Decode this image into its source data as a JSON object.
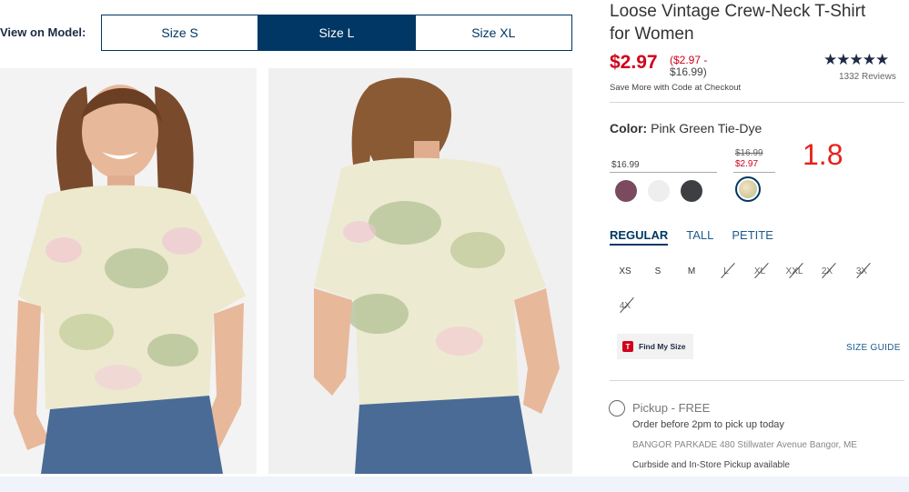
{
  "view_on_model": {
    "label": "View on Model:",
    "options": [
      "Size S",
      "Size L",
      "Size XL"
    ],
    "selected": "Size L"
  },
  "product": {
    "title": "Loose Vintage Crew-Neck T-Shirt for Women",
    "price": "$2.97",
    "price_range_sale": "($2.97 -",
    "price_range_regular": "$16.99)",
    "save_more": "Save More with Code at Checkout",
    "rating_stars": "★★★★★",
    "reviews": "1332 Reviews"
  },
  "color": {
    "label": "Color:",
    "value": "Pink Green Tie-Dye",
    "regular_price": "$16.99",
    "strike_price": "$16.99",
    "sale_price": "$2.97",
    "swatch_colors": [
      "#7b4a5e",
      "#eeeeee",
      "#3d3f42"
    ],
    "selected_swatch": "tie-dye"
  },
  "annotation": "1.8",
  "fit": {
    "tabs": [
      "REGULAR",
      "TALL",
      "PETITE"
    ],
    "selected": "REGULAR"
  },
  "sizes": [
    {
      "label": "XS",
      "available": true
    },
    {
      "label": "S",
      "available": true
    },
    {
      "label": "M",
      "available": true
    },
    {
      "label": "L",
      "available": false
    },
    {
      "label": "XL",
      "available": false
    },
    {
      "label": "XXL",
      "available": false
    },
    {
      "label": "2X",
      "available": false
    },
    {
      "label": "3X",
      "available": false
    },
    {
      "label": "4X",
      "available": false
    }
  ],
  "find_my_size": {
    "icon_letter": "T",
    "label": "Find My Size"
  },
  "size_guide": "SIZE GUIDE",
  "pickup": {
    "label": "Pickup - FREE",
    "order_before": "Order before 2pm to pick up today",
    "store": "BANGOR PARKADE 480 Stillwater Avenue  Bangor, ME",
    "curbside": "Curbside and In-Store Pickup available"
  },
  "colors": {
    "navy": "#003764",
    "sale_red": "#d0021b",
    "annotation_red": "#e8201c"
  }
}
